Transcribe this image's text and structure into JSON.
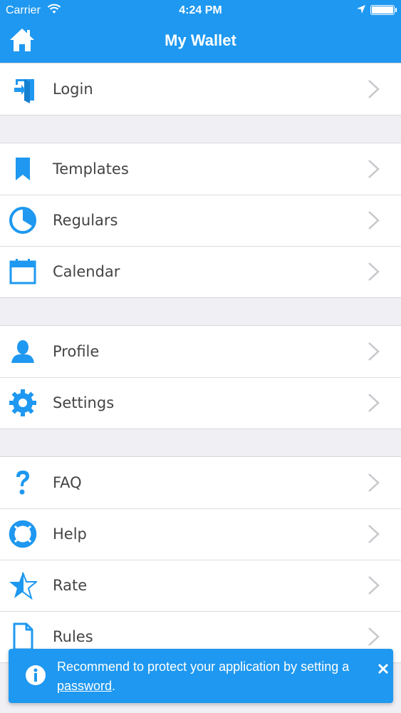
{
  "status_bar": {
    "carrier": "Carrier",
    "time": "4:24 PM"
  },
  "nav": {
    "title": "My Wallet",
    "home_icon": "home-icon"
  },
  "menu": {
    "group1": [
      {
        "label": "Login",
        "icon": "login-icon"
      }
    ],
    "group2": [
      {
        "label": "Templates",
        "icon": "bookmark-icon"
      },
      {
        "label": "Regulars",
        "icon": "clock-icon"
      },
      {
        "label": "Calendar",
        "icon": "calendar-icon"
      }
    ],
    "group3": [
      {
        "label": "Profile",
        "icon": "person-icon"
      },
      {
        "label": "Settings",
        "icon": "gear-icon"
      }
    ],
    "group4": [
      {
        "label": "FAQ",
        "icon": "question-icon"
      },
      {
        "label": "Help",
        "icon": "lifebuoy-icon"
      },
      {
        "label": "Rate",
        "icon": "star-icon"
      },
      {
        "label": "Rules",
        "icon": "document-icon"
      }
    ]
  },
  "toast": {
    "message": "Recommend to protect your application by setting a",
    "link": "password",
    "suffix": ".",
    "icon": "info-icon"
  },
  "colors": {
    "accent": "#1e98f0",
    "background": "#efeff4",
    "text": "#444444"
  }
}
